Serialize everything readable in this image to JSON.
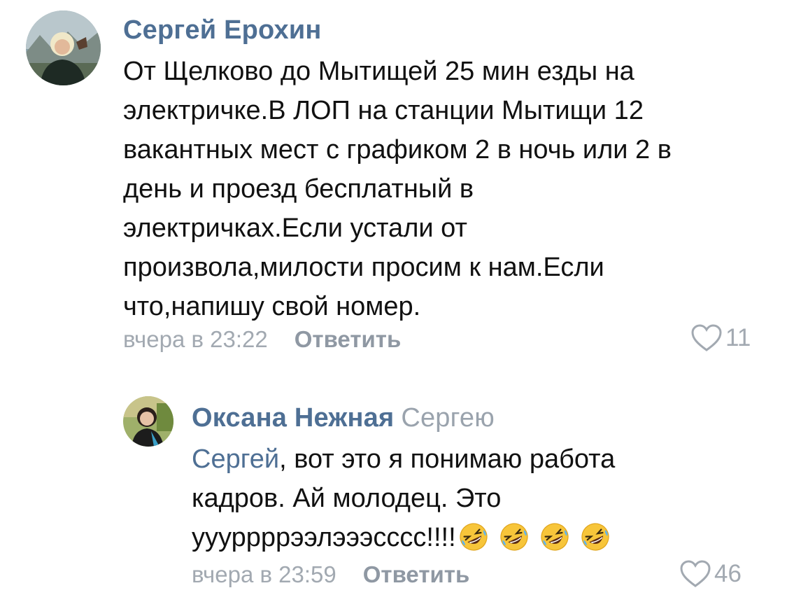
{
  "comments": [
    {
      "author": "Сергей Ерохин",
      "text_lines": [
        "От Щелково до Мытищей 25 мин езды на",
        "электричке.В ЛОП на станции Мытищи 12",
        "вакантных мест с графиком 2 в ночь или 2 в",
        "день и проезд бесплатный в",
        "электричках.Если устали от",
        "произвола,милости просим к нам.Если",
        "что,напишу свой номер."
      ],
      "time": "вчера в 23:22",
      "reply_label": "Ответить",
      "likes": "11",
      "avatar_icon": "user-avatar-photo"
    },
    {
      "author": "Оксана Нежная",
      "reply_to": "Сергею",
      "mention": "Сергей",
      "text_lines": [
        ", вот это я понимаю работа",
        "кадров. Ай молодец. Это",
        "уууррррээлэээсссс!!!!"
      ],
      "emoji_icon": "rolling-on-floor-laughing-emoji",
      "emoji_count": 4,
      "time": "вчера в 23:59",
      "reply_label": "Ответить",
      "likes": "46",
      "avatar_icon": "user-avatar-photo"
    }
  ],
  "colors": {
    "author": "#4e6f94",
    "text": "#111111",
    "meta": "#a2a9b1",
    "reply_button": "#8f98a3"
  }
}
